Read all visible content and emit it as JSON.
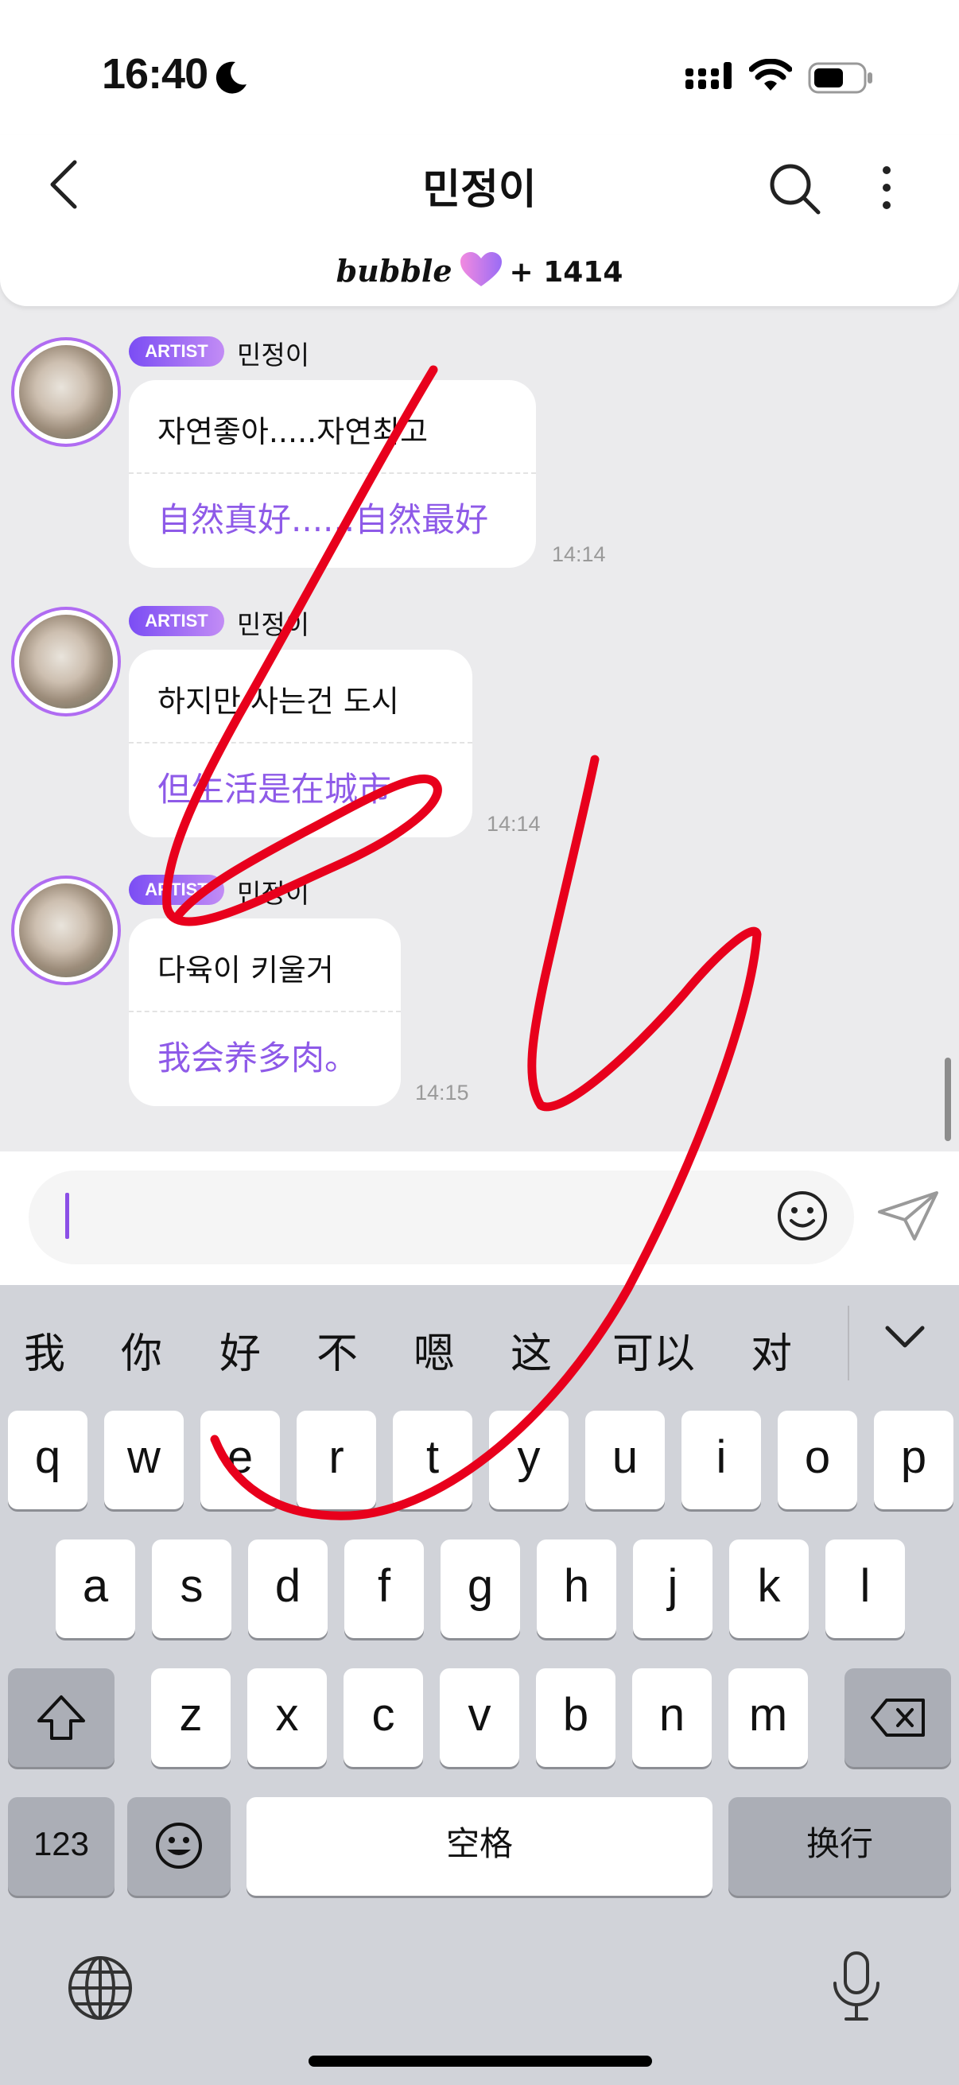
{
  "status_bar": {
    "time": "16:40",
    "moon_icon": "moon-icon",
    "signal_icon": "signal-icon",
    "wifi_icon": "wifi-icon",
    "battery_icon": "battery-icon"
  },
  "header": {
    "title": "민정이",
    "back_icon": "chevron-left-icon",
    "search_icon": "search-icon",
    "more_icon": "more-vertical-icon"
  },
  "bubble_bar": {
    "logo": "bubble",
    "heart_icon": "heart-icon",
    "count": "+ 1414"
  },
  "messages": [
    {
      "badge": "ARTIST",
      "sender": "민정이",
      "korean": "자연좋아.....자연최고",
      "chinese": "自然真好......自然最好",
      "time": "14:14"
    },
    {
      "badge": "ARTIST",
      "sender": "민정이",
      "korean": "하지만 사는건 도시",
      "chinese": "但生活是在城市",
      "time": "14:14"
    },
    {
      "badge": "ARTIST",
      "sender": "민정이",
      "korean": "다육이 키울거",
      "chinese": "我会养多肉。",
      "time": "14:15"
    }
  ],
  "input": {
    "placeholder": "",
    "emoji_icon": "smiley-icon",
    "send_icon": "paper-plane-icon"
  },
  "keyboard": {
    "candidates": [
      "我",
      "你",
      "好",
      "不",
      "嗯",
      "这",
      "可以",
      "对"
    ],
    "row1": [
      "q",
      "w",
      "e",
      "r",
      "t",
      "y",
      "u",
      "i",
      "o",
      "p"
    ],
    "row2": [
      "a",
      "s",
      "d",
      "f",
      "g",
      "h",
      "j",
      "k",
      "l"
    ],
    "row3": [
      "z",
      "x",
      "c",
      "v",
      "b",
      "n",
      "m"
    ],
    "numbers_key": "123",
    "space_key": "空格",
    "return_key": "换行",
    "shift_icon": "shift-icon",
    "delete_icon": "delete-icon",
    "emoji_key_icon": "emoji-icon",
    "globe_icon": "globe-icon",
    "mic_icon": "microphone-icon",
    "collapse_icon": "chevron-down-icon"
  },
  "colors": {
    "accent": "#8b4fe6",
    "badge_start": "#7b4df4",
    "badge_end": "#c28cf5",
    "annotation": "#e8001c"
  }
}
